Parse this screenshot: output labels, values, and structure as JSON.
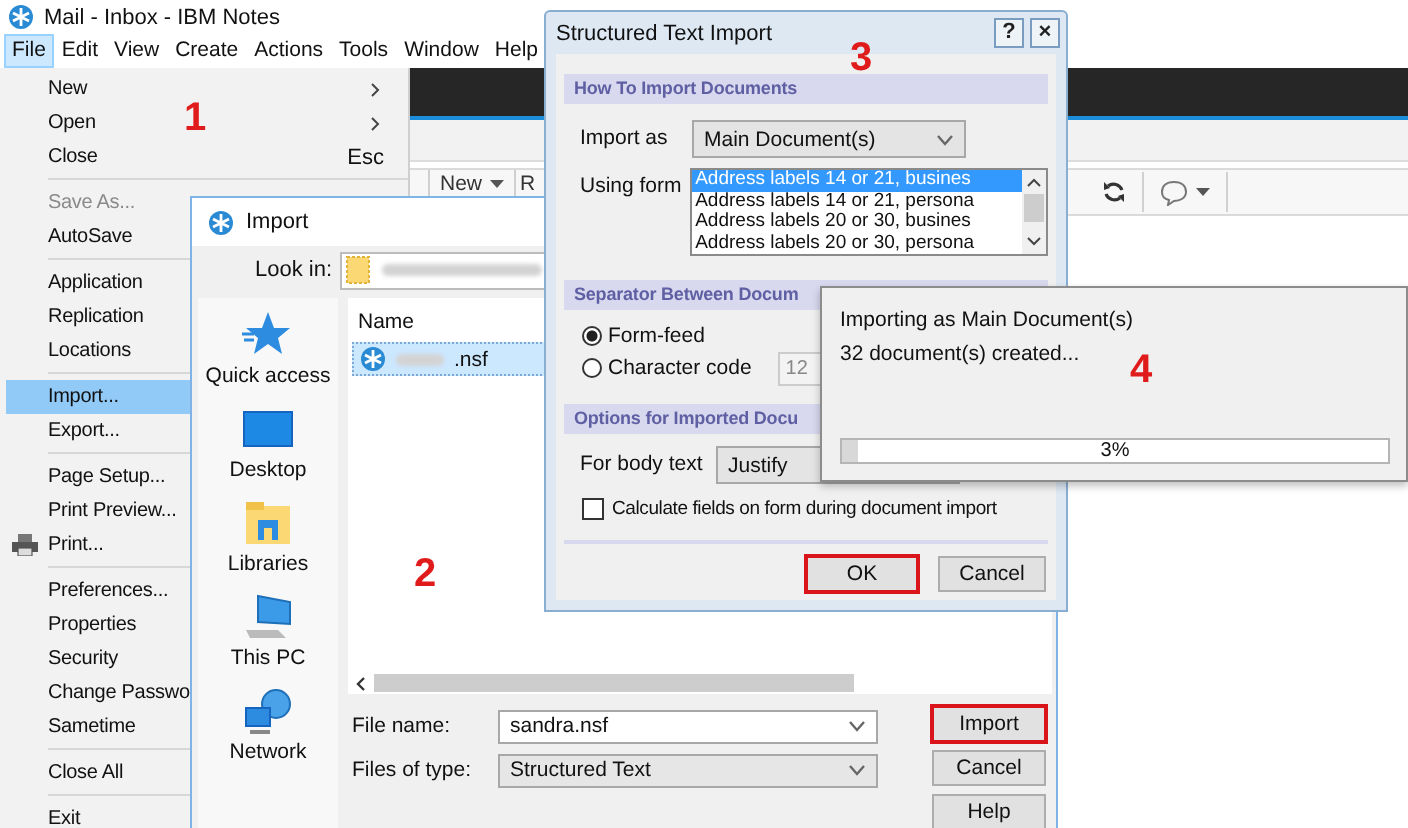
{
  "main_window": {
    "title": "Mail - Inbox - IBM Notes",
    "menu": [
      {
        "label": "File",
        "selected": true
      },
      {
        "label": "Edit",
        "selected": false
      },
      {
        "label": "View",
        "selected": false
      },
      {
        "label": "Create",
        "selected": false
      },
      {
        "label": "Actions",
        "selected": false
      },
      {
        "label": "Tools",
        "selected": false
      },
      {
        "label": "Window",
        "selected": false
      },
      {
        "label": "Help",
        "selected": false
      }
    ],
    "toolbar": [
      {
        "label": "New",
        "kind": "dropdown"
      },
      {
        "label": "R",
        "kind": "plain"
      }
    ]
  },
  "file_menu": {
    "step_label": "1",
    "groups": [
      [
        {
          "label": "New",
          "submenu": true,
          "disabled": false,
          "selected": false
        },
        {
          "label": "Open",
          "submenu": true,
          "disabled": false,
          "selected": false
        },
        {
          "label": "Close",
          "shortcut": "Esc",
          "disabled": false,
          "selected": false
        }
      ],
      [
        {
          "label": "Save As...",
          "disabled": true,
          "selected": false
        },
        {
          "label": "AutoSave",
          "disabled": false,
          "selected": false
        }
      ],
      [
        {
          "label": "Application",
          "disabled": false,
          "selected": false
        },
        {
          "label": "Replication",
          "disabled": false,
          "selected": false
        },
        {
          "label": "Locations",
          "disabled": false,
          "selected": false
        }
      ],
      [
        {
          "label": "Import...",
          "disabled": false,
          "selected": true
        },
        {
          "label": "Export...",
          "disabled": false,
          "selected": false
        }
      ],
      [
        {
          "label": "Page Setup...",
          "disabled": false,
          "selected": false
        },
        {
          "label": "Print Preview...",
          "disabled": false,
          "selected": false
        },
        {
          "label": "Print...",
          "has_icon": true,
          "disabled": false,
          "selected": false
        }
      ],
      [
        {
          "label": "Preferences...",
          "disabled": false,
          "selected": false
        },
        {
          "label": "Properties",
          "disabled": false,
          "selected": false
        },
        {
          "label": "Security",
          "disabled": false,
          "selected": false
        },
        {
          "label": "Change Passwo",
          "disabled": false,
          "selected": false
        },
        {
          "label": "Sametime",
          "disabled": false,
          "selected": false
        }
      ],
      [
        {
          "label": "Close All",
          "disabled": false,
          "selected": false
        }
      ],
      [
        {
          "label": "Exit",
          "disabled": false,
          "selected": false
        }
      ]
    ]
  },
  "import_dialog": {
    "title": "Import",
    "step_label": "2",
    "look_in_label": "Look in:",
    "places": [
      {
        "label": "Quick access",
        "kind": "star"
      },
      {
        "label": "Desktop",
        "kind": "desktop"
      },
      {
        "label": "Libraries",
        "kind": "libraries"
      },
      {
        "label": "This PC",
        "kind": "computer"
      },
      {
        "label": "Network",
        "kind": "network"
      }
    ],
    "file_list": {
      "column": "Name",
      "rows": [
        {
          "name": ".nsf",
          "selected": true
        }
      ]
    },
    "file_name": {
      "label": "File name:",
      "value": "sandra.nsf"
    },
    "file_type": {
      "label": "Files of type:",
      "value": "Structured Text"
    },
    "buttons": [
      {
        "label": "Import",
        "highlighted": true
      },
      {
        "label": "Cancel",
        "highlighted": false
      },
      {
        "label": "Help",
        "highlighted": false
      }
    ]
  },
  "structured_import": {
    "title": "Structured Text Import",
    "title_buttons": [
      "?",
      "×"
    ],
    "step_label": "3",
    "how_heading": "How To Import Documents",
    "import_as": {
      "label": "Import as",
      "value": "Main Document(s)"
    },
    "using_form": {
      "label": "Using form",
      "options": [
        {
          "label": "Address labels 14 or 21, busines",
          "selected": true
        },
        {
          "label": "Address labels 14 or 21, persona",
          "selected": false
        },
        {
          "label": "Address labels 20 or 30, busines",
          "selected": false
        },
        {
          "label": "Address labels 20 or 30, persona",
          "selected": false
        }
      ]
    },
    "separator_heading": "Separator Between Docum",
    "separator_options": [
      {
        "label": "Form-feed",
        "selected": true
      },
      {
        "label": "Character code",
        "selected": false
      }
    ],
    "character_code": "12",
    "options_heading": "Options for Imported Docu",
    "body_text": {
      "label": "For body text",
      "value": "Justify"
    },
    "calculate_fields": {
      "label": "Calculate fields on form during document import",
      "checked": false
    },
    "buttons": [
      {
        "label": "OK",
        "highlighted": true
      },
      {
        "label": "Cancel",
        "highlighted": false
      }
    ]
  },
  "progress_dialog": {
    "status": "Importing as Main Document(s)",
    "count": "32 document(s) created...",
    "step_label": "4",
    "progress": {
      "level": 0.03,
      "reading": "3%"
    }
  }
}
